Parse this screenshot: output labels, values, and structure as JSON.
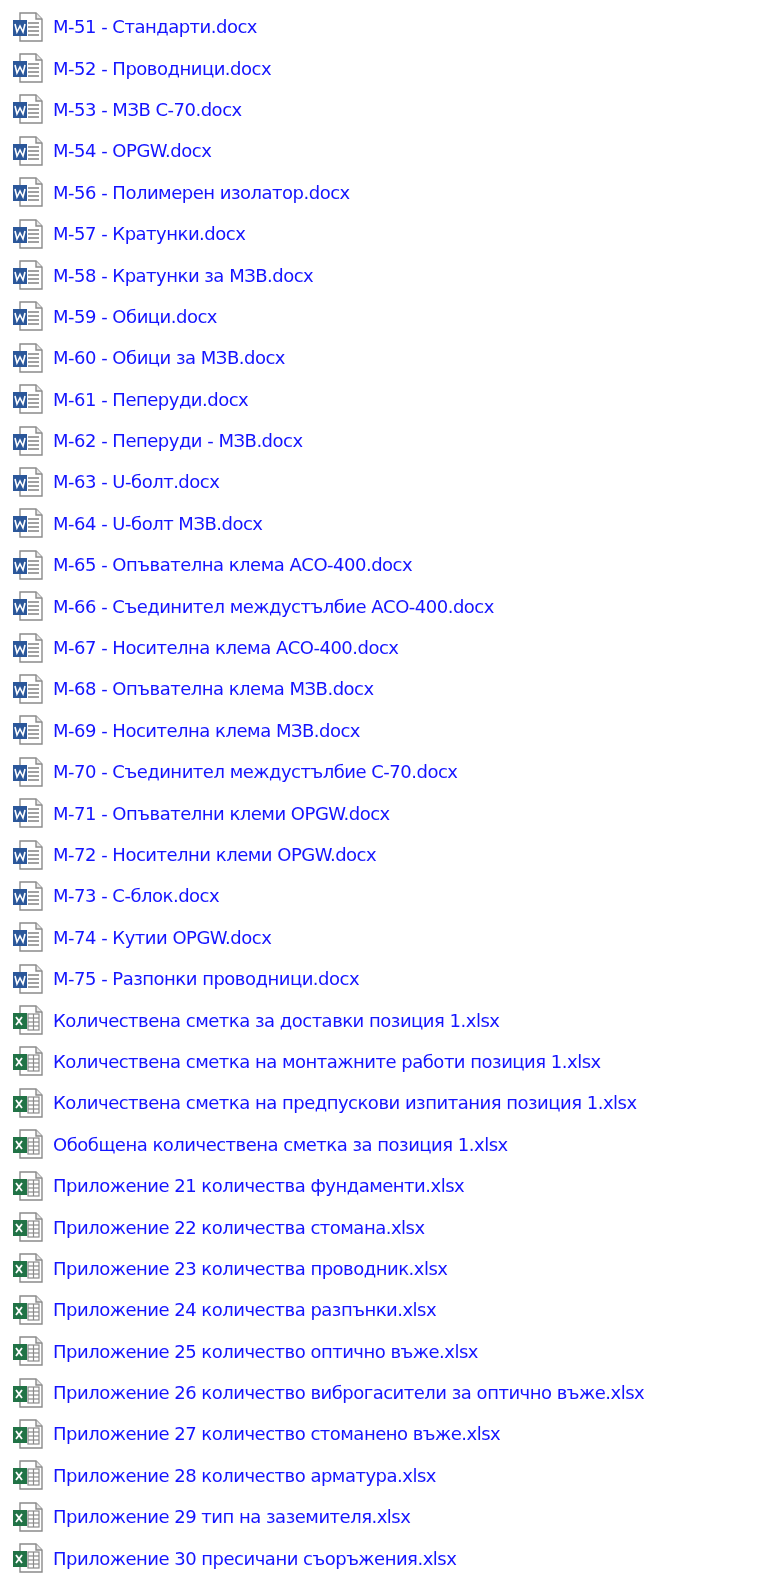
{
  "files": [
    {
      "kind": "word",
      "name": "М-51 - Стандарти.docx"
    },
    {
      "kind": "word",
      "name": "М-52 - Проводници.docx"
    },
    {
      "kind": "word",
      "name": "М-53 - МЗВ С-70.docx"
    },
    {
      "kind": "word",
      "name": "М-54 - OPGW.docx"
    },
    {
      "kind": "word",
      "name": "М-56 - Полимерен изолатор.docx"
    },
    {
      "kind": "word",
      "name": "М-57 - Кратунки.docx"
    },
    {
      "kind": "word",
      "name": "М-58 - Кратунки за МЗВ.docx"
    },
    {
      "kind": "word",
      "name": "М-59 - Обици.docx"
    },
    {
      "kind": "word",
      "name": "М-60 - Обици за МЗВ.docx"
    },
    {
      "kind": "word",
      "name": "М-61 - Пеперуди.docx"
    },
    {
      "kind": "word",
      "name": "М-62 - Пеперуди - МЗВ.docx"
    },
    {
      "kind": "word",
      "name": "М-63 - U-болт.docx"
    },
    {
      "kind": "word",
      "name": "М-64 - U-болт МЗВ.docx"
    },
    {
      "kind": "word",
      "name": "М-65 - Опъвателна клема АСО-400.docx"
    },
    {
      "kind": "word",
      "name": "М-66 - Съединител междустълбие АСО-400.docx"
    },
    {
      "kind": "word",
      "name": "М-67 - Носителна клема АСО-400.docx"
    },
    {
      "kind": "word",
      "name": "М-68 - Опъвателна клема МЗВ.docx"
    },
    {
      "kind": "word",
      "name": "М-69 - Носителна клема МЗВ.docx"
    },
    {
      "kind": "word",
      "name": "М-70 - Съединител междустълбие С-70.docx"
    },
    {
      "kind": "word",
      "name": "М-71 - Опъвателни клеми OPGW.docx"
    },
    {
      "kind": "word",
      "name": "М-72 - Носителни клеми OPGW.docx"
    },
    {
      "kind": "word",
      "name": "М-73 - С-блок.docx"
    },
    {
      "kind": "word",
      "name": "М-74 - Кутии OPGW.docx"
    },
    {
      "kind": "word",
      "name": "М-75 - Разпонки проводници.docx"
    },
    {
      "kind": "excel",
      "name": "Количествена сметка за доставки позиция 1.xlsx"
    },
    {
      "kind": "excel",
      "name": "Количествена сметка на монтажните работи позиция 1.xlsx"
    },
    {
      "kind": "excel",
      "name": "Количествена сметка на предпускови изпитания позиция 1.xlsx"
    },
    {
      "kind": "excel",
      "name": "Обобщена количествена сметка за позиция 1.xlsx"
    },
    {
      "kind": "excel",
      "name": "Приложение 21 количества фундаменти.xlsx"
    },
    {
      "kind": "excel",
      "name": "Приложение 22 количества стомана.xlsx"
    },
    {
      "kind": "excel",
      "name": "Приложение 23 количества проводник.xlsx"
    },
    {
      "kind": "excel",
      "name": "Приложение 24 количества разпънки.xlsx"
    },
    {
      "kind": "excel",
      "name": "Приложение 25 количество оптично въже.xlsx"
    },
    {
      "kind": "excel",
      "name": "Приложение 26 количество виброгасители за оптично въже.xlsx"
    },
    {
      "kind": "excel",
      "name": "Приложение 27 количество стоманено въже.xlsx"
    },
    {
      "kind": "excel",
      "name": "Приложение 28 количество арматура.xlsx"
    },
    {
      "kind": "excel",
      "name": "Приложение 29 тип на заземителя.xlsx"
    },
    {
      "kind": "excel",
      "name": "Приложение 30 пресичани съоръжения.xlsx"
    }
  ]
}
